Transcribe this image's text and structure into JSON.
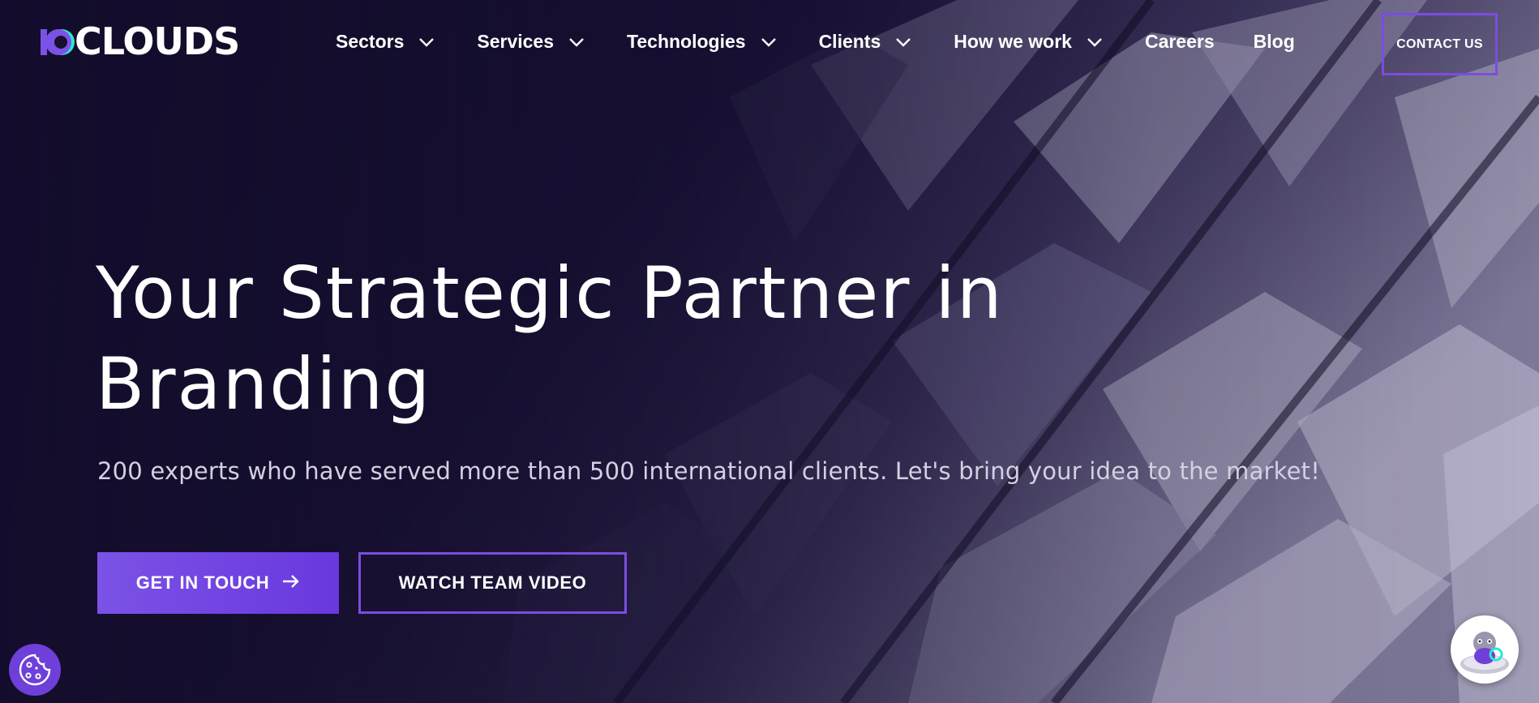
{
  "brand": {
    "logo_mark": "10",
    "logo_text": "CLOUDS",
    "accent": "#6e3fd9",
    "accent_light": "#7b52e6",
    "logo_cyan": "#2ee6d0"
  },
  "nav": {
    "items": [
      {
        "label": "Sectors",
        "dropdown": true
      },
      {
        "label": "Services",
        "dropdown": true
      },
      {
        "label": "Technologies",
        "dropdown": true
      },
      {
        "label": "Clients",
        "dropdown": true
      },
      {
        "label": "How we work",
        "dropdown": true
      },
      {
        "label": "Careers",
        "dropdown": false
      },
      {
        "label": "Blog",
        "dropdown": false
      }
    ],
    "contact_label": "CONTACT US"
  },
  "hero": {
    "title_line1": "Your Strategic Partner in",
    "title_line2": "Branding",
    "subtitle": "200 experts who have served more than 500 international clients. Let's bring your idea to the market!",
    "primary_cta": "GET IN TOUCH",
    "secondary_cta": "WATCH TEAM VIDEO"
  },
  "icons": {
    "nav_chevron": "chevron-down-icon",
    "cta_arrow": "arrow-right-icon",
    "cookie": "cookie-icon",
    "chat": "chat-mascot-icon"
  }
}
